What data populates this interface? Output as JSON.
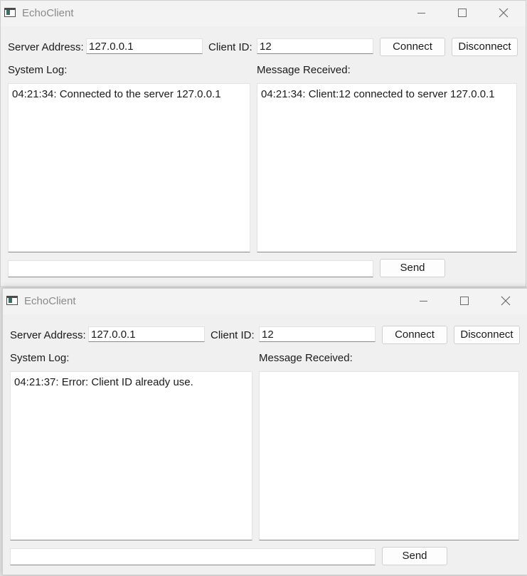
{
  "windows": [
    {
      "title": "EchoClient",
      "server_address_label": "Server Address:",
      "server_address_value": "127.0.0.1",
      "client_id_label": "Client ID:",
      "client_id_value": "12",
      "connect_label": "Connect",
      "disconnect_label": "Disconnect",
      "system_log_label": "System Log:",
      "message_received_label": "Message Received:",
      "system_log_lines": [
        "04:21:34: Connected to the server 127.0.0.1"
      ],
      "message_received_lines": [
        "04:21:34: Client:12 connected to server 127.0.0.1"
      ],
      "message_input_value": "",
      "send_label": "Send"
    },
    {
      "title": "EchoClient",
      "server_address_label": "Server Address:",
      "server_address_value": "127.0.0.1",
      "client_id_label": "Client ID:",
      "client_id_value": "12",
      "connect_label": "Connect",
      "disconnect_label": "Disconnect",
      "system_log_label": "System Log:",
      "message_received_label": "Message Received:",
      "system_log_lines": [
        "04:21:37: Error: Client ID already use."
      ],
      "message_received_lines": [],
      "message_input_value": "",
      "send_label": "Send"
    }
  ],
  "icons": {
    "app": "app-window-icon",
    "minimize": "minimize-icon",
    "maximize": "maximize-icon",
    "close": "close-icon"
  }
}
